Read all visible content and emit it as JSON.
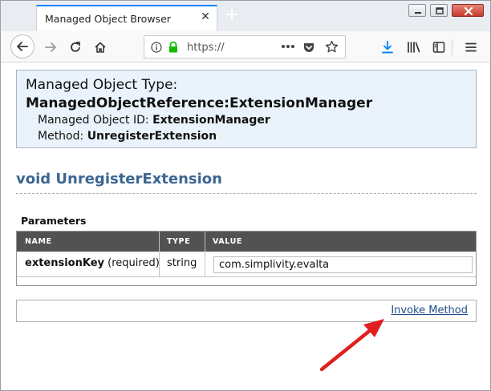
{
  "tab": {
    "title": "Managed Object Browser",
    "close_glyph": "✕",
    "new_tab_glyph": "+"
  },
  "url": {
    "text": "https://"
  },
  "icons": [
    "back-arrow-icon",
    "forward-arrow-icon",
    "reload-icon",
    "home-icon",
    "info-icon",
    "lock-icon",
    "more-icon",
    "pocket-icon",
    "bookmark-star-icon",
    "download-icon",
    "library-icon",
    "sidebar-icon",
    "menu-icon"
  ],
  "colors": {
    "accent": "#0a84ff",
    "heading": "#3c6692",
    "table_header": "#525252",
    "info_bg": "#eaf3fb",
    "lock": "#12bc00",
    "download": "#0a84ff",
    "arrow": "#e02020"
  },
  "object": {
    "type_label": "Managed Object Type:",
    "type_value": "ManagedObjectReference:ExtensionManager",
    "id_label": "Managed Object ID:",
    "id_value": "ExtensionManager",
    "method_label": "Method:",
    "method_value": "UnregisterExtension"
  },
  "method_signature": "void UnregisterExtension",
  "parameters": {
    "label": "Parameters",
    "columns": [
      "NAME",
      "TYPE",
      "VALUE"
    ],
    "rows": [
      {
        "name": "extensionKey",
        "qualifier": "(required)",
        "type": "string",
        "value": "com.simplivity.evalta"
      }
    ]
  },
  "invoke_label": "Invoke Method"
}
